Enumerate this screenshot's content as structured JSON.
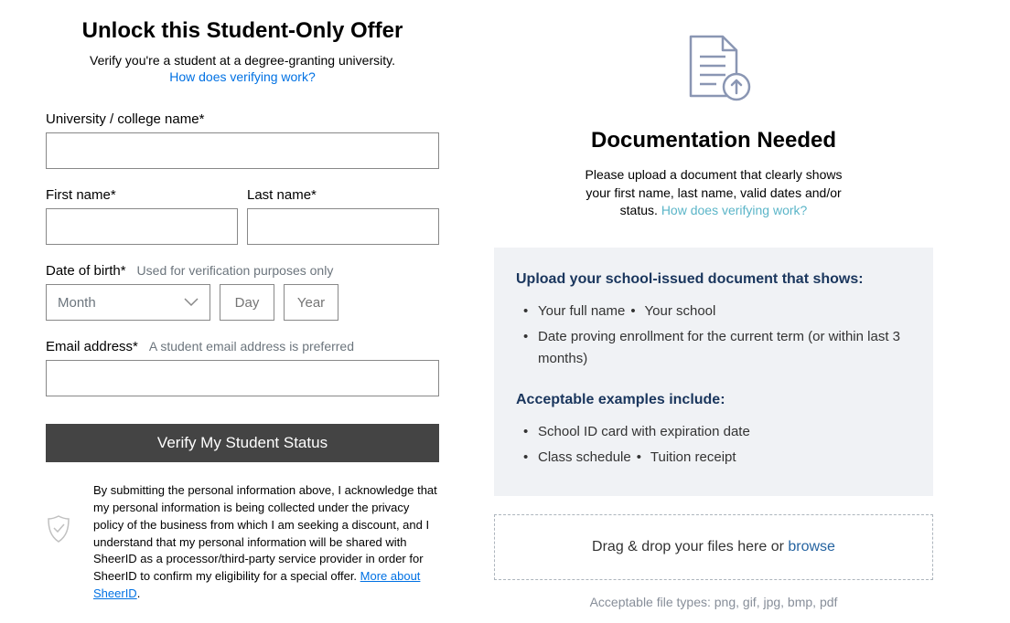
{
  "left": {
    "title": "Unlock this Student-Only Offer",
    "subtitle": "Verify you're a student at a degree-granting university.",
    "how_link": "How does verifying work?",
    "university_label": "University / college name*",
    "first_name_label": "First name*",
    "last_name_label": "Last name*",
    "dob_label": "Date of birth*",
    "dob_hint": "Used for verification purposes only",
    "month_placeholder": "Month",
    "day_placeholder": "Day",
    "year_placeholder": "Year",
    "email_label": "Email address*",
    "email_hint": "A student email address is preferred",
    "verify_button": "Verify My Student Status",
    "disclaimer_pre": "By submitting the personal information above, I acknowledge that my personal information is being collected under the privacy policy of the business from which I am seeking a discount, and I understand that my personal information will be shared with SheerID as a processor/third-party service provider in order for SheerID to confirm my eligibility for a special offer. ",
    "disclaimer_link": "More about SheerID",
    "disclaimer_post": "."
  },
  "right": {
    "title": "Documentation Needed",
    "subtitle_pre": "Please upload a document that clearly shows your first name, last name, valid dates and/or status. ",
    "subtitle_link": "How does verifying work?",
    "req_heading": "Upload your school-issued document that shows:",
    "req_items": {
      "a": "Your full name",
      "b": "Your school",
      "c": "Date proving enrollment for the current term (or within last 3 months)"
    },
    "examples_heading": "Acceptable examples include:",
    "examples": {
      "a": "School ID card with expiration date",
      "b": "Class schedule",
      "c": "Tuition receipt"
    },
    "drop_text": "Drag & drop your files here or ",
    "browse": "browse",
    "filetypes": "Acceptable file types: png, gif, jpg, bmp, pdf",
    "bullet": "•"
  }
}
